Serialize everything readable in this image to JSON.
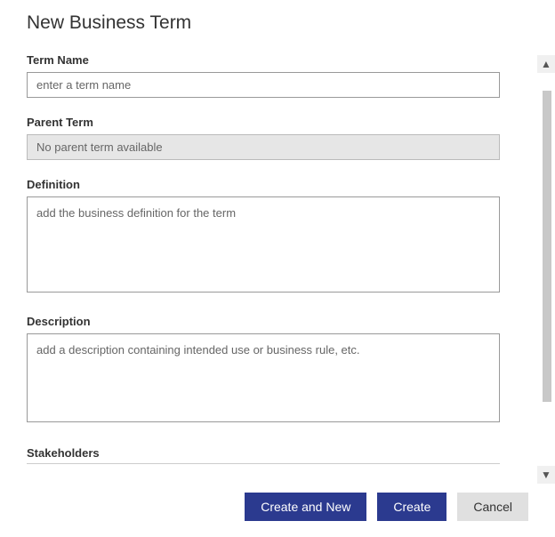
{
  "title": "New Business Term",
  "fields": {
    "termName": {
      "label": "Term Name",
      "placeholder": "enter a term name",
      "value": ""
    },
    "parentTerm": {
      "label": "Parent Term",
      "value": "No parent term available"
    },
    "definition": {
      "label": "Definition",
      "placeholder": "add the business definition for the term",
      "value": ""
    },
    "description": {
      "label": "Description",
      "placeholder": "add a description containing intended use or business rule, etc.",
      "value": ""
    }
  },
  "sections": {
    "stakeholders": "Stakeholders"
  },
  "buttons": {
    "createAndNew": "Create and New",
    "create": "Create",
    "cancel": "Cancel"
  },
  "icons": {
    "arrowUp": "▲",
    "arrowDown": "▼"
  }
}
